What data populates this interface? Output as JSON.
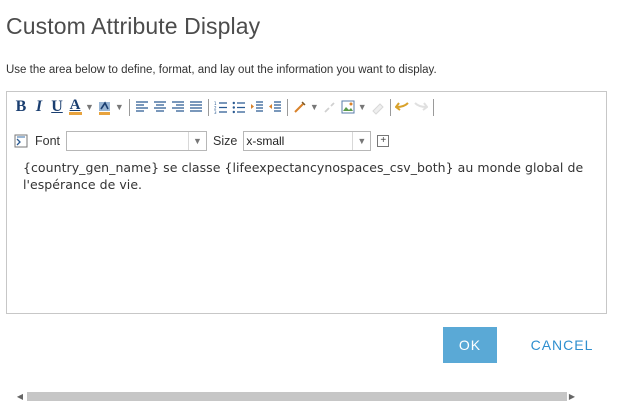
{
  "dialog": {
    "title": "Custom Attribute Display",
    "instruction": "Use the area below to define, format, and lay out the information you want to display."
  },
  "toolbar": {
    "bold": "B",
    "italic": "I",
    "underline": "U",
    "font_color": "A",
    "font_label": "Font",
    "font_value": "",
    "size_label": "Size",
    "size_value": "x-small"
  },
  "editor": {
    "content": "{country_gen_name} se classe {lifeexpectancynospaces_csv_both} au monde global de l'espérance de vie."
  },
  "buttons": {
    "ok": "OK",
    "cancel": "CANCEL"
  },
  "colors": {
    "primary": "#5aa9d6",
    "link": "#2f8fcf",
    "title_text": "#4c4c4c"
  }
}
